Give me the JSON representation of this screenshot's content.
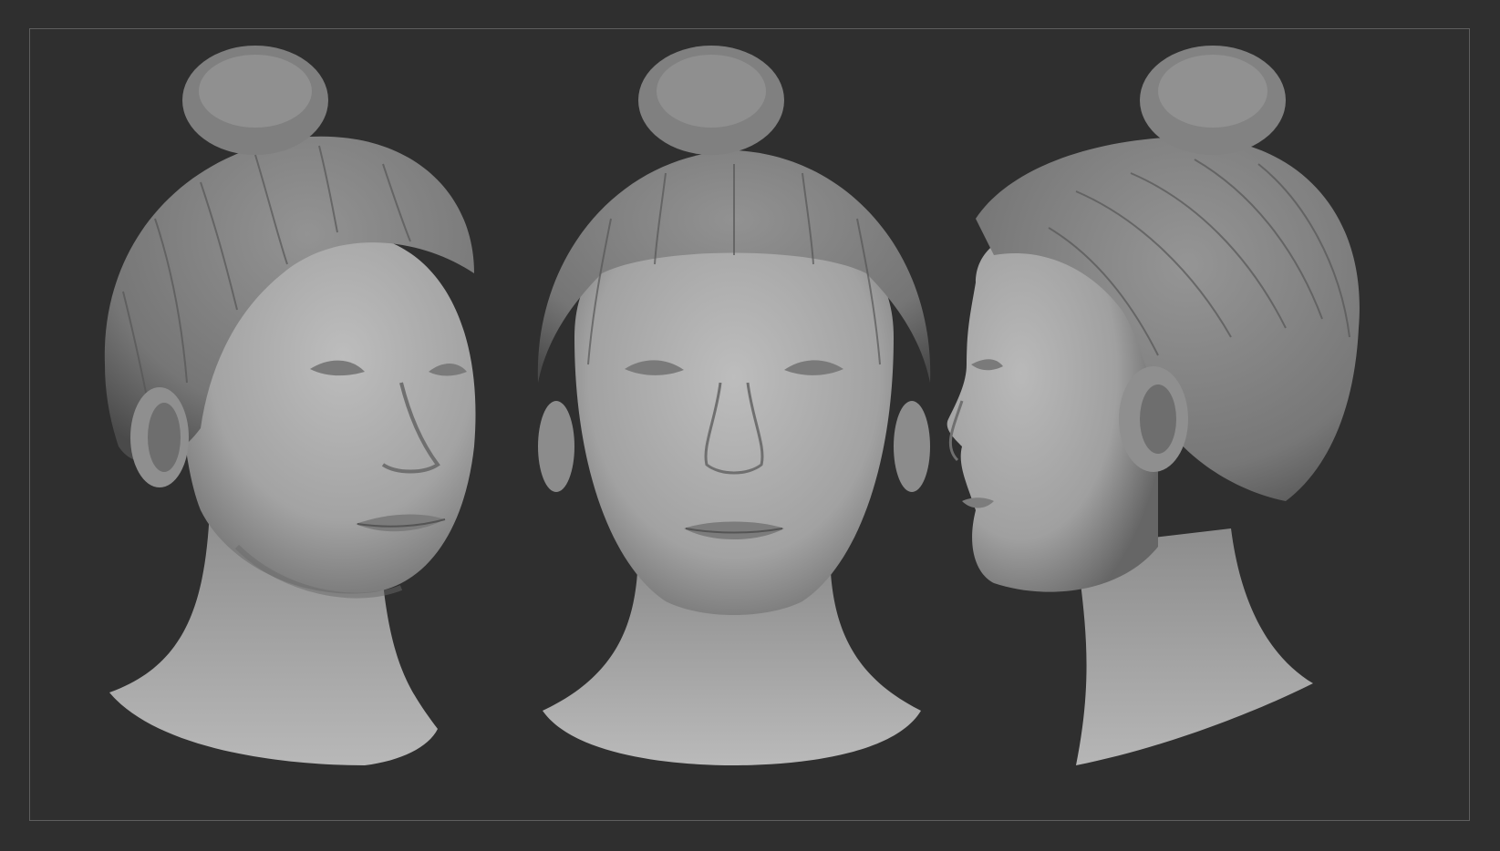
{
  "scene": {
    "description_colors": {
      "background": "#2f2f2f",
      "frame": "#5e5e5e",
      "skin_light": "#b4b4b4",
      "skin_mid": "#9a9a9a",
      "skin_dark": "#5a5a5a",
      "hair_light": "#8c8c8c",
      "hair_dark": "#4f4f4f"
    },
    "views": [
      {
        "id": "three-quarter",
        "icon": "sculpt-head-three-quarter"
      },
      {
        "id": "front",
        "icon": "sculpt-head-front"
      },
      {
        "id": "profile",
        "icon": "sculpt-head-profile"
      }
    ]
  }
}
